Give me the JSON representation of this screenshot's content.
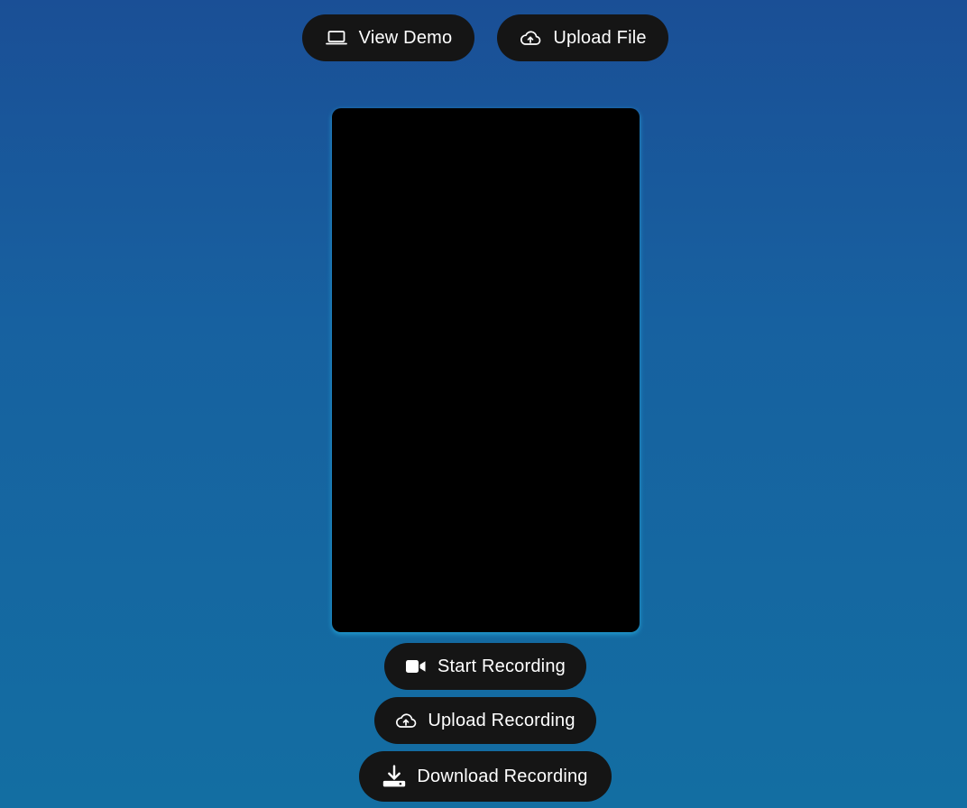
{
  "top_actions": {
    "view_demo": {
      "label": "View Demo",
      "icon": "laptop-icon"
    },
    "upload_file": {
      "label": "Upload File",
      "icon": "cloud-upload-icon"
    }
  },
  "video": {
    "state": "blank"
  },
  "recording_actions": {
    "start": {
      "label": "Start Recording",
      "icon": "video-camera-icon"
    },
    "upload": {
      "label": "Upload Recording",
      "icon": "cloud-upload-icon"
    },
    "download": {
      "label": "Download Recording",
      "icon": "download-icon"
    }
  },
  "colors": {
    "background_top": "#1a4f96",
    "background_bottom": "#136ea2",
    "button_bg": "#151515",
    "button_text": "#ffffff",
    "video_bg": "#000000",
    "video_glow": "#28b4e6"
  }
}
